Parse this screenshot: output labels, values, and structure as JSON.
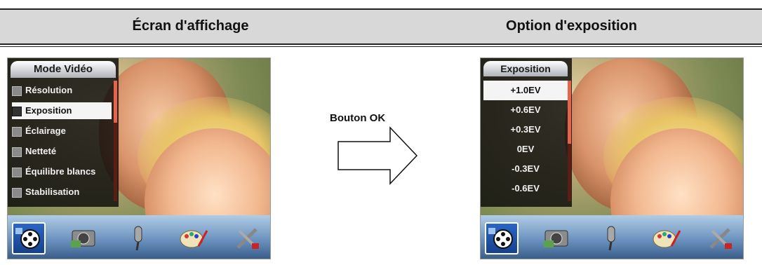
{
  "headers": {
    "left": "Écran d'affichage",
    "right": "Option d'exposition"
  },
  "left_screen": {
    "menu_title": "Mode Vidéo",
    "menu_items": [
      {
        "label": "Résolution",
        "selected": false,
        "icon": "resolution-icon"
      },
      {
        "label": "Exposition",
        "selected": true,
        "icon": "exposure-icon"
      },
      {
        "label": "Éclairage",
        "selected": false,
        "icon": "lighting-icon"
      },
      {
        "label": "Netteté",
        "selected": false,
        "icon": "sharpness-icon"
      },
      {
        "label": "Équilibre blancs",
        "selected": false,
        "icon": "white-balance-icon"
      },
      {
        "label": "Stabilisation",
        "selected": false,
        "icon": "stabilization-icon"
      }
    ]
  },
  "right_screen": {
    "menu_title": "Exposition",
    "options": [
      "+1.0EV",
      "+0.6EV",
      "+0.3EV",
      "0EV",
      "-0.3EV",
      "-0.6EV"
    ],
    "selected_option": "+1.0EV"
  },
  "mode_bar": {
    "icons": [
      "video-mode-icon",
      "camera-mode-icon",
      "voice-mode-icon",
      "palette-mode-icon",
      "tools-mode-icon"
    ],
    "active": "video-mode-icon"
  },
  "center": {
    "button_label": "Bouton OK",
    "arrow": "right-arrow-icon"
  },
  "colors": {
    "header_bg": "#d8d8d8",
    "menu_selected_bg": "#f4f4f4",
    "scrollbar": "#e5644d",
    "mode_bar": "#6d94c0"
  }
}
